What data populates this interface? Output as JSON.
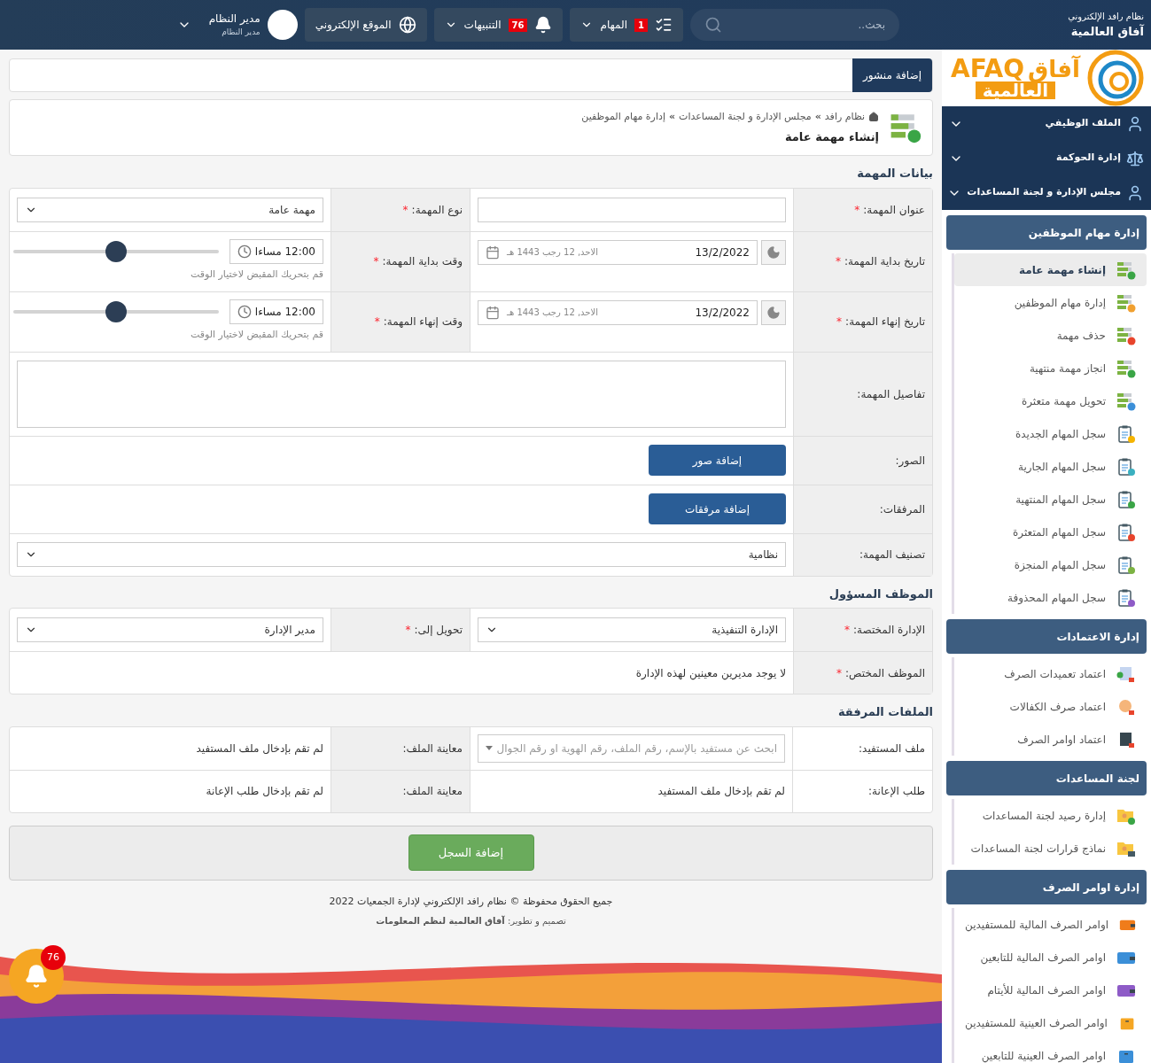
{
  "topbar": {
    "brand_line1": "نظام رافد الإلكتروني",
    "brand_line2": "آفاق العالمية",
    "search_placeholder": "بحث..",
    "tasks": {
      "label": "المهام",
      "count": "1"
    },
    "notifications": {
      "label": "التنبيهات",
      "count": "76"
    },
    "website": "الموقع الإلكتروني",
    "user": {
      "name": "مدير النظام",
      "role": "مدير النظام"
    }
  },
  "required_mark": "*",
  "add_post": "إضافة منشور",
  "page_header": {
    "breadcrumb": [
      "نظام رافد",
      "مجلس الإدارة و لجنة المساعدات",
      "إدارة مهام الموظفين"
    ],
    "separator": "»",
    "title": "إنشاء مهمة عامة"
  },
  "task_data": {
    "title": "بيانات المهمة",
    "task_title": {
      "label": "عنوان المهمة:",
      "required": true
    },
    "task_type": {
      "label": "نوع المهمة:",
      "required": true,
      "value": "مهمة عامة"
    },
    "schedule": [
      {
        "date_label": "تاريخ بداية المهمة:",
        "date_required": true,
        "date": "13/2/2022",
        "hijri": "الاحد, 12 رجب 1443 هـ",
        "time_label": "وقت بداية المهمة:",
        "time_required": true,
        "time": "12:00 مساءا",
        "hint": "قم بتحريك المقبض لاختيار الوقت",
        "level": 0.5
      },
      {
        "date_label": "تاريخ إنهاء المهمة:",
        "date_required": true,
        "date": "13/2/2022",
        "hijri": "الاحد, 12 رجب 1443 هـ",
        "time_label": "وقت إنهاء المهمة:",
        "time_required": true,
        "time": "12:00 مساءا",
        "hint": "قم بتحريك المقبض لاختيار الوقت",
        "level": 0.5
      }
    ],
    "details": {
      "label": "تفاصيل المهمة:",
      "required": false
    },
    "photos": {
      "label": "الصور:",
      "required": false,
      "button": "إضافة صور"
    },
    "attachments": {
      "label": "المرفقات:",
      "required": false,
      "button": "إضافة مرفقات"
    },
    "classification": {
      "label": "تصنيف المهمة:",
      "required": false,
      "value": "نظامية"
    }
  },
  "responsible": {
    "title": "الموظف المسؤول",
    "department": {
      "label": "الإدارة المختصة:",
      "required": true,
      "value": "الإدارة التنفيذية"
    },
    "transfer_to": {
      "label": "تحويل إلى:",
      "required": true,
      "value": "مدير الإدارة"
    },
    "employee": {
      "label": "الموظف المختص:",
      "required": true,
      "value": "لا يوجد مديرين معينين لهذه الإدارة"
    }
  },
  "attached_files": {
    "title": "الملفات المرفقة",
    "rows": [
      {
        "kind": "select",
        "label": "ملف المستفيد:",
        "placeholder": "ابحث عن مستفيد بالإسم، رقم الملف، رقم الهوية او رقم الجوال",
        "preview_label": "معاينة الملف:",
        "preview": "لم تقم بإدخال ملف المستفيد"
      },
      {
        "kind": "text",
        "label": "طلب الإعانة:",
        "value": "لم تقم بإدخال ملف المستفيد",
        "preview_label": "معاينة الملف:",
        "preview": "لم تقم بإدخال طلب الإعانة"
      }
    ]
  },
  "submit": "إضافة السجل",
  "footer": {
    "copyright": "جميع الحقوق محفوظة © نظام رافد الإلكتروني لإدارة الجمعيات 2022",
    "credit": "تصميم و تطوير: **آفاق العالمية لنظم المعلومات**"
  },
  "floating_notifications": {
    "count": "76"
  },
  "sidebar": {
    "logo": {
      "latin": "AFAQ",
      "arabic_top": "آفاق",
      "arabic_bottom": "العالمية"
    },
    "main_menu": [
      "الملف الوظيفي",
      "إدارة الحوكمة",
      "مجلس الإدارة و لجنة المساعدات"
    ],
    "groups": [
      {
        "title": "إدارة مهام الموظفين",
        "items": [
          {
            "label": "إنشاء مهمة عامة",
            "selected": true
          },
          {
            "label": "إدارة مهام الموظفين",
            "selected": false
          },
          {
            "label": "حذف مهمة",
            "selected": false
          },
          {
            "label": "انجاز مهمة منتهية",
            "selected": false
          },
          {
            "label": "تحويل مهمة متعثرة",
            "selected": false
          },
          {
            "label": "سجل المهام الجديدة",
            "selected": false
          },
          {
            "label": "سجل المهام الجارية",
            "selected": false
          },
          {
            "label": "سجل المهام المنتهية",
            "selected": false
          },
          {
            "label": "سجل المهام المتعثرة",
            "selected": false
          },
          {
            "label": "سجل المهام المنجزة",
            "selected": false
          },
          {
            "label": "سجل المهام المحذوفة",
            "selected": false
          }
        ]
      },
      {
        "title": "إدارة الاعتمادات",
        "items": [
          {
            "label": "اعتماد تعميدات الصرف",
            "selected": false
          },
          {
            "label": "اعتماد صرف الكفالات",
            "selected": false
          },
          {
            "label": "اعتماد اوامر الصرف",
            "selected": false
          }
        ]
      },
      {
        "title": "لجنة المساعدات",
        "items": [
          {
            "label": "إدارة رصيد لجنة المساعدات",
            "selected": false
          },
          {
            "label": "نماذج قرارات لجنة المساعدات",
            "selected": false
          }
        ]
      },
      {
        "title": "إدارة اوامر الصرف",
        "items": [
          {
            "label": "اوامر الصرف المالية للمستفيدين",
            "selected": false
          },
          {
            "label": "اوامر الصرف المالية للتابعين",
            "selected": false
          },
          {
            "label": "اوامر الصرف المالية للأيتام",
            "selected": false
          },
          {
            "label": "اوامر الصرف العينية للمستفيدين",
            "selected": false
          },
          {
            "label": "اوامر الصرف العينية للتابعين",
            "selected": false
          }
        ]
      }
    ]
  }
}
